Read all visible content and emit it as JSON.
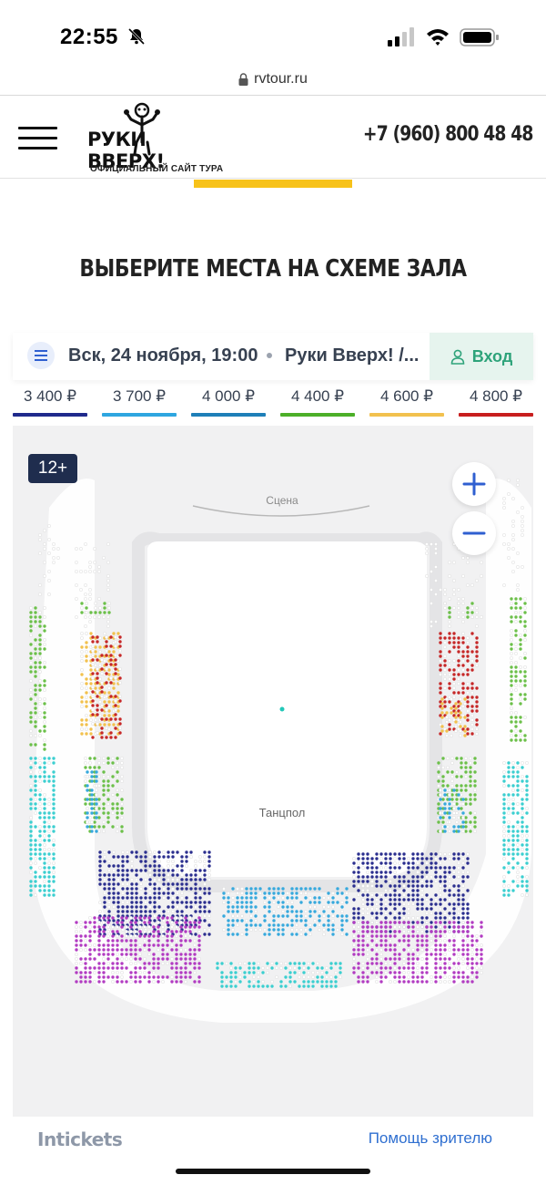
{
  "status_bar": {
    "time": "22:55"
  },
  "browser": {
    "url": "rvtour.ru"
  },
  "header": {
    "brand_name": "РУКИ ВВЕРХ!",
    "brand_sub": "ОФИЦИАЛЬНЫЙ САЙТ ТУРА",
    "phone": "+7 (960) 800 48 48"
  },
  "page": {
    "title": "ВЫБЕРИТЕ МЕСТА НА СХЕМЕ ЗАЛА"
  },
  "event": {
    "date": "Вск, 24 ноября, 19:00",
    "name": "Руки Вверх! /...",
    "login_label": "Вход"
  },
  "prices": [
    {
      "label": "3 400 ₽",
      "color": "#1f2a8c"
    },
    {
      "label": "3 700 ₽",
      "color": "#2ea6e0"
    },
    {
      "label": "4 000 ₽",
      "color": "#1e7fb8"
    },
    {
      "label": "4 400 ₽",
      "color": "#4caf28"
    },
    {
      "label": "4 600 ₽",
      "color": "#f2c14e"
    },
    {
      "label": "4 800 ₽",
      "color": "#c81e1e"
    }
  ],
  "hall": {
    "age_rating": "12+",
    "zoom_in": "+",
    "zoom_out": "−",
    "scene_label": "Сцена",
    "dance_floor_label": "Танцпол",
    "seat_colors": {
      "dark_blue": "#2b2f8f",
      "light_blue": "#37a9dd",
      "teal": "#3ccfd0",
      "green": "#6cc04a",
      "yellow": "#f2c14e",
      "red": "#c62828",
      "purple": "#b23cc2",
      "empty": "#ffffff"
    }
  },
  "footer": {
    "logo": "Intickets",
    "help_link": "Помощь зрителю"
  },
  "icons": [
    "bell-slash-icon",
    "signal-icon",
    "wifi-icon",
    "battery-icon",
    "lock-icon",
    "menu-icon",
    "filter-icon",
    "user-icon",
    "plus-icon",
    "minus-icon"
  ]
}
